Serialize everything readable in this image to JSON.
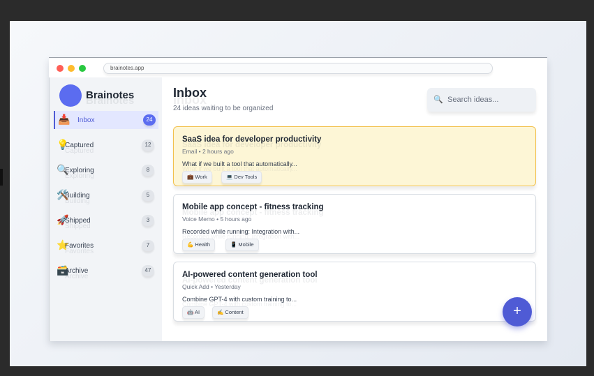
{
  "browser": {
    "url": "brainotes.app"
  },
  "sidebar": {
    "brand": "Brainotes",
    "items": [
      {
        "icon": "📥",
        "label": "Inbox",
        "count": "24"
      },
      {
        "icon": "💡",
        "label": "Captured",
        "count": "12"
      },
      {
        "icon": "🔍",
        "label": "Exploring",
        "count": "8"
      },
      {
        "icon": "🛠️",
        "label": "Building",
        "count": "5"
      },
      {
        "icon": "🚀",
        "label": "Shipped",
        "count": "3"
      },
      {
        "icon": "⭐",
        "label": "Favorites",
        "count": "7"
      },
      {
        "icon": "🗃️",
        "label": "Archive",
        "count": "47"
      }
    ]
  },
  "main": {
    "title": "Inbox",
    "subtitle": "24 ideas waiting to be organized",
    "search": {
      "icon": "🔍",
      "placeholder": "Search ideas..."
    },
    "cards": [
      {
        "title": "SaaS idea for developer productivity",
        "meta": "Email • 2 hours ago",
        "body": "What if we built a tool that automatically...",
        "tags": [
          "💼 Work",
          "💻 Dev Tools"
        ]
      },
      {
        "title": "Mobile app concept - fitness tracking",
        "meta": "Voice Memo • 5 hours ago",
        "body": "Recorded while running: Integration with...",
        "tags": [
          "💪 Health",
          "📱 Mobile"
        ]
      },
      {
        "title": "AI-powered content generation tool",
        "meta": "Quick Add • Yesterday",
        "body": "Combine GPT-4 with custom training to...",
        "tags": [
          "🤖 AI",
          "✍️ Content"
        ]
      }
    ]
  },
  "fab": {
    "label": "+"
  }
}
